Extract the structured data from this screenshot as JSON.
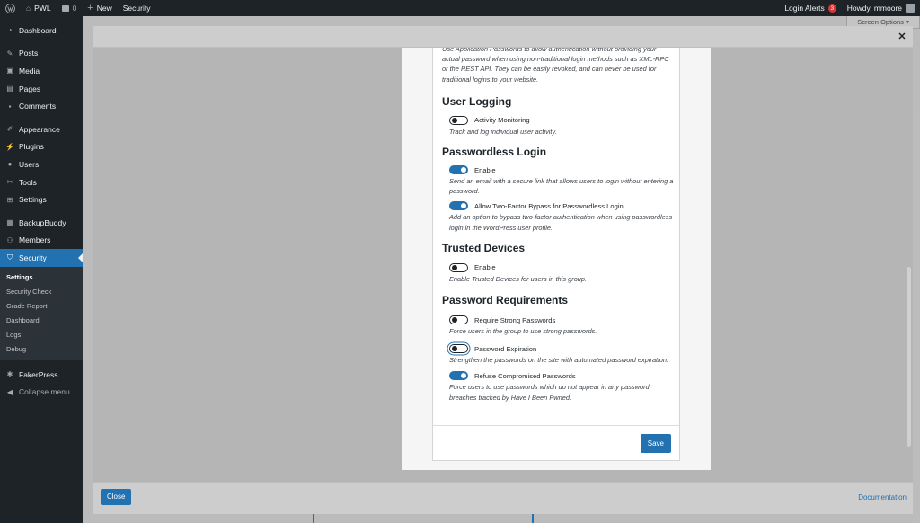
{
  "adminbar": {
    "site_name": "PWL",
    "comments_count": "0",
    "new_label": "New",
    "security_label": "Security",
    "login_alerts_label": "Login Alerts",
    "login_alerts_count": "3",
    "howdy": "Howdy, mmoore"
  },
  "sidebar": {
    "items": [
      {
        "label": "Dashboard",
        "icon": "dashboard-icon"
      },
      {
        "label": "Posts",
        "icon": "pin-icon"
      },
      {
        "label": "Media",
        "icon": "media-icon"
      },
      {
        "label": "Pages",
        "icon": "page-icon"
      },
      {
        "label": "Comments",
        "icon": "comment-icon"
      },
      {
        "label": "Appearance",
        "icon": "brush-icon"
      },
      {
        "label": "Plugins",
        "icon": "plug-icon"
      },
      {
        "label": "Users",
        "icon": "user-icon"
      },
      {
        "label": "Tools",
        "icon": "wrench-icon"
      },
      {
        "label": "Settings",
        "icon": "settings-icon"
      },
      {
        "label": "BackupBuddy",
        "icon": "backup-icon"
      },
      {
        "label": "Members",
        "icon": "members-icon"
      },
      {
        "label": "Security",
        "icon": "shield-icon"
      }
    ],
    "security_submenu": [
      "Settings",
      "Security Check",
      "Grade Report",
      "Dashboard",
      "Logs",
      "Debug"
    ],
    "fakerpress": "FakerPress",
    "collapse": "Collapse menu"
  },
  "screen_options": "Screen Options ▾",
  "modal": {
    "close_label": "Close",
    "documentation_label": "Documentation"
  },
  "dialog": {
    "intro_desc": "Use Application Passwords to allow authentication without providing your actual password when using non-traditional login methods such as XML-RPC or the REST API. They can be easily revoked, and can never be used for traditional logins to your website.",
    "sections": {
      "user_logging": {
        "title": "User Logging",
        "activity_label": "Activity Monitoring",
        "activity_desc": "Track and log individual user activity.",
        "activity_on": false
      },
      "passwordless": {
        "title": "Passwordless Login",
        "enable_label": "Enable",
        "enable_desc": "Send an email with a secure link that allows users to login without entering a password.",
        "enable_on": true,
        "bypass_label": "Allow Two-Factor Bypass for Passwordless Login",
        "bypass_desc": "Add an option to bypass two-factor authentication when using passwordless login in the WordPress user profile.",
        "bypass_on": true
      },
      "trusted_devices": {
        "title": "Trusted Devices",
        "enable_label": "Enable",
        "enable_desc": "Enable Trusted Devices for users in this group.",
        "enable_on": false
      },
      "password_requirements": {
        "title": "Password Requirements",
        "strong_label": "Require Strong Passwords",
        "strong_desc": "Force users in the group to use strong passwords.",
        "strong_on": false,
        "expiration_label": "Password Expiration",
        "expiration_desc": "Strengthen the passwords on the site with automated password expiration.",
        "expiration_on": false,
        "compromised_label": "Refuse Compromised Passwords",
        "compromised_desc": "Force users to use passwords which do not appear in any password breaches tracked by Have I Been Pwned.",
        "compromised_on": true
      }
    },
    "save_label": "Save"
  },
  "colors": {
    "wp_blue": "#2271b1",
    "admin_dark": "#1d2327",
    "alert_red": "#d63638"
  }
}
